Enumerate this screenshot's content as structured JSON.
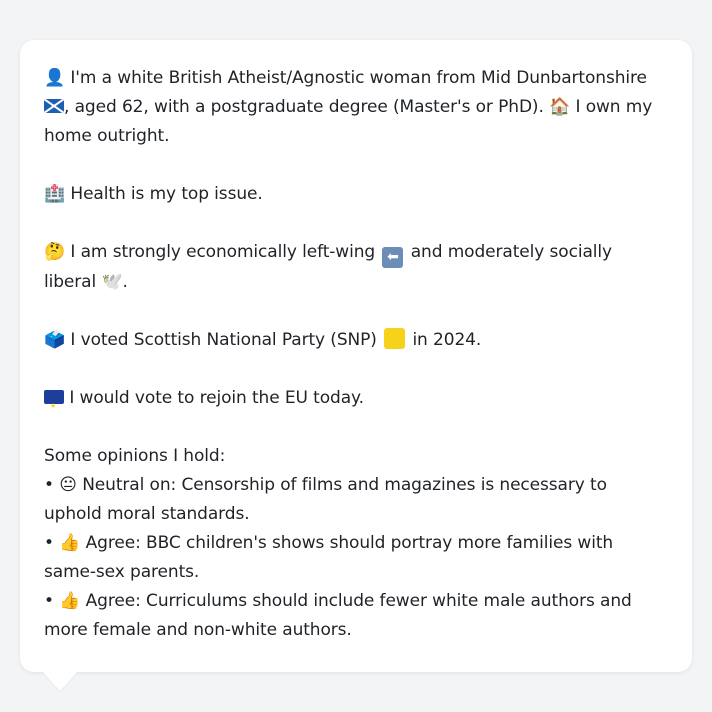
{
  "profile": {
    "intro_part1": "I'm a white British Atheist/Agnostic woman from Mid Dunbartonshire",
    "intro_part2": ", aged 62, with a postgraduate degree (Master's or PhD).",
    "intro_part3": "I own my home outright.",
    "health": "Health is my top issue.",
    "economics_part1": "I am strongly economically left-wing",
    "economics_part2": "and moderately socially liberal",
    "economics_part3": ".",
    "vote_part1": "I voted Scottish National Party (SNP)",
    "vote_part2": "in 2024.",
    "eu": "I would vote to rejoin the EU today.",
    "opinions_heading": "Some opinions I hold:",
    "opinions": [
      {
        "bullet": "•",
        "stance": "Neutral on:",
        "text": "Censorship of films and magazines is necessary to uphold moral standards."
      },
      {
        "bullet": "•",
        "stance": "Agree:",
        "text": "BBC children's shows should portray more families with same-sex parents."
      },
      {
        "bullet": "•",
        "stance": "Agree:",
        "text": "Curriculums should include fewer white male authors and more female and non-white authors."
      }
    ]
  },
  "icons": {
    "person": "👤",
    "house": "🏠",
    "hospital": "🏥",
    "thinking": "🤔",
    "left_arrow": "⬅",
    "dove": "🕊️",
    "ballot": "🗳️",
    "neutral": "😐",
    "thumbs_up": "👍"
  },
  "colors": {
    "snp_yellow": "#f7d21a",
    "scotland_blue": "#1d5fb3",
    "eu_blue": "#1d3f9b"
  }
}
